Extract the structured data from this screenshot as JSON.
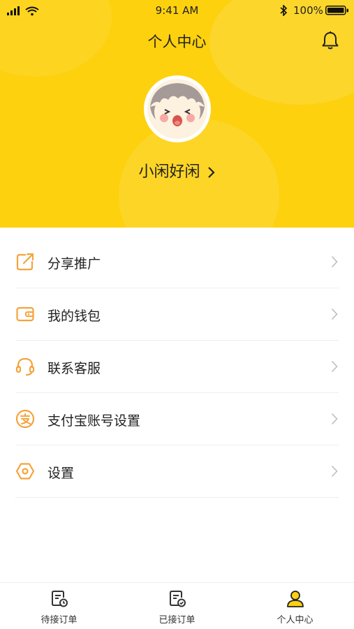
{
  "status_bar": {
    "time": "9:41 AM",
    "battery": "100%"
  },
  "header": {
    "title": "个人中心",
    "username": "小闲好闲"
  },
  "menu": [
    {
      "label": "分享推广",
      "icon": "share-icon"
    },
    {
      "label": "我的钱包",
      "icon": "wallet-icon"
    },
    {
      "label": "联系客服",
      "icon": "headset-icon"
    },
    {
      "label": "支付宝账号设置",
      "icon": "alipay-icon"
    },
    {
      "label": "设置",
      "icon": "settings-icon"
    }
  ],
  "tabs": [
    {
      "label": "待接订单",
      "icon": "pending-orders-icon",
      "active": false
    },
    {
      "label": "已接订单",
      "icon": "accepted-orders-icon",
      "active": false
    },
    {
      "label": "个人中心",
      "icon": "profile-icon",
      "active": true
    }
  ],
  "colors": {
    "header_bg": "#FDD10E",
    "icon_orange": "#F5A33A",
    "text": "#222222"
  }
}
